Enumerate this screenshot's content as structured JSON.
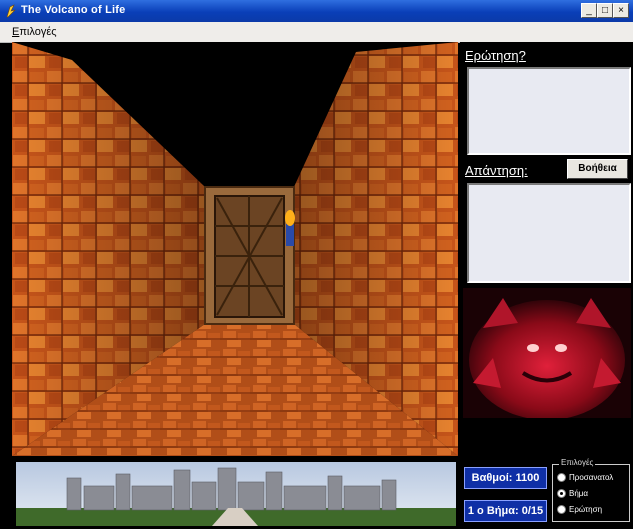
{
  "window": {
    "title": "The Volcano of Life",
    "minimize": "_",
    "maximize": "□",
    "close": "×"
  },
  "menu": {
    "options_label": "Επιλογές"
  },
  "side": {
    "question_label": "Ερώτηση?",
    "answer_label": "Απάντηση:",
    "help_button": "Βοήθεια",
    "score_label": "Βαθμοί: 1100",
    "level_label": "1 ο Βήμα: 0/15"
  },
  "options": {
    "legend": "Επιλογές",
    "items": [
      {
        "label": "Προσανατολ",
        "selected": false
      },
      {
        "label": "Βήμα",
        "selected": true
      },
      {
        "label": "Ερώτηση",
        "selected": false
      }
    ]
  },
  "colors": {
    "title_blue": "#0a3fb8",
    "stat_blue": "#0f2fa6",
    "rock_orange": "#d7621a"
  },
  "scene": {
    "type": "first-person corridor with wooden door",
    "background": "castle silhouette"
  }
}
